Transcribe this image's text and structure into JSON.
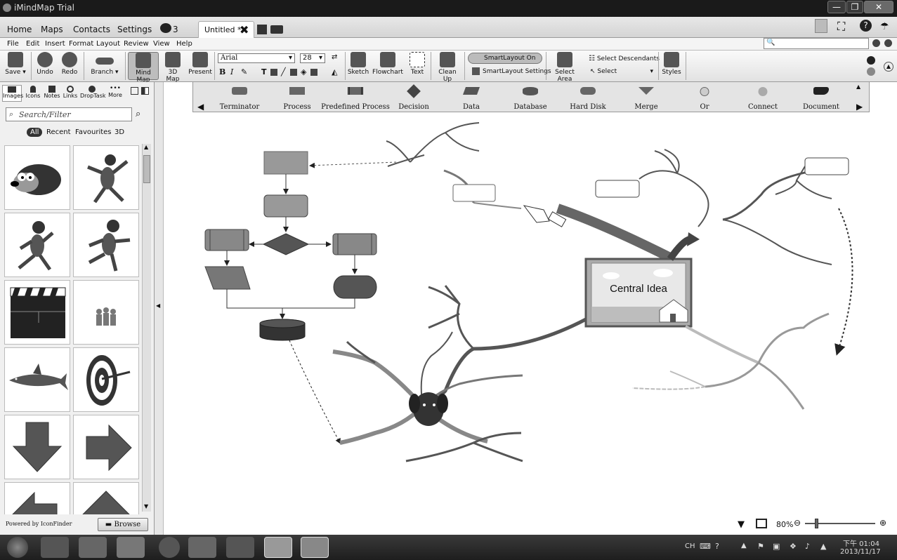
{
  "window": {
    "title": "iMindMap Trial",
    "buttons": [
      "—",
      "❐",
      "✕"
    ]
  },
  "nav": {
    "items": [
      "Home",
      "Maps",
      "Contacts",
      "Settings"
    ],
    "comment_count": "3",
    "doc_tab": "Untitled *"
  },
  "menu": [
    "File",
    "Edit",
    "Insert",
    "Format",
    "Layout",
    "Review",
    "View",
    "Help"
  ],
  "ribbon": {
    "save": "Save",
    "undo": "Undo",
    "redo": "Redo",
    "branch": "Branch",
    "mind_map": "Mind Map",
    "map3d": "3D Map",
    "present": "Present",
    "font": "Arial",
    "font_size": "28",
    "sketch": "Sketch",
    "flowchart": "Flowchart",
    "text": "Text",
    "clean_up": "Clean Up",
    "smartlayout_on": "SmartLayout On",
    "smartlayout_settings": "SmartLayout Settings",
    "select_area": "Select Area",
    "select_descendants": "Select Descendants",
    "select": "Select",
    "styles": "Styles"
  },
  "sidebar": {
    "tabs": [
      "Images",
      "Icons",
      "Notes",
      "Links",
      "DropTask",
      "More"
    ],
    "search_placeholder": "Search/Filter",
    "filters": [
      "All",
      "Recent",
      "Favourites",
      "3D"
    ],
    "powered_by": "Powered by IconFinder",
    "browse": "Browse"
  },
  "shapes": [
    "Terminator",
    "Process",
    "Predefined Process",
    "Decision",
    "Data",
    "Database",
    "Hard Disk",
    "Merge",
    "Or",
    "Connect",
    "Document"
  ],
  "map": {
    "central_idea": "Central Idea"
  },
  "zoom": {
    "level": "80%"
  },
  "clock": {
    "time": "下午 01:04",
    "date": "2013/11/17",
    "lang": "CH"
  }
}
